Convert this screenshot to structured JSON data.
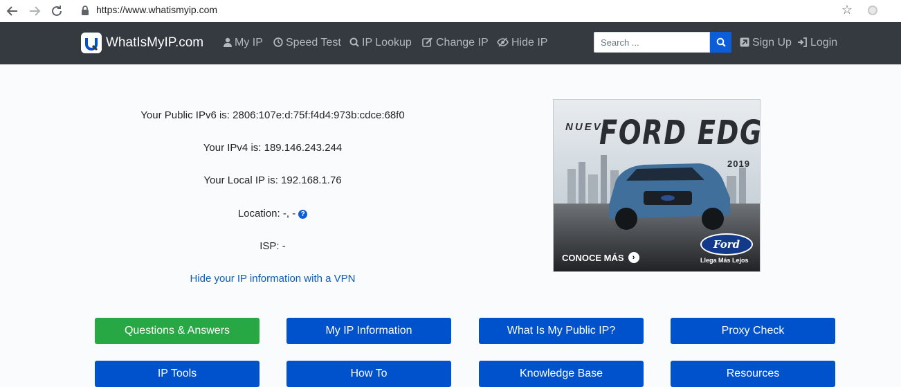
{
  "browser": {
    "url": "https://www.whatismyip.com"
  },
  "navbar": {
    "logo_text": "WhatIsMyIP.com",
    "items": [
      {
        "label": "My IP",
        "icon": "user-icon"
      },
      {
        "label": "Speed Test",
        "icon": "stopwatch-icon"
      },
      {
        "label": "IP Lookup",
        "icon": "search-icon"
      },
      {
        "label": "Change IP",
        "icon": "edit-icon"
      },
      {
        "label": "Hide IP",
        "icon": "eye-slash-icon"
      }
    ],
    "search_placeholder": "Search ...",
    "sign_up": "Sign Up",
    "login": "Login"
  },
  "ip_info": {
    "ipv6": "Your Public IPv6 is: 2806:107e:d:75f:f4d4:973b:cdce:68f0",
    "ipv4": "Your IPv4 is: 189.146.243.244",
    "local_ip": "Your Local IP is: 192.168.1.76",
    "location": "Location: -, -",
    "isp": "ISP: -",
    "vpn_link": "Hide your IP information with a VPN"
  },
  "ad": {
    "nueva": "NUEVA",
    "model": "FORD EDGE",
    "year": "2019",
    "cta": "CONOCE MÁS",
    "brand": "Ford",
    "tagline": "Llega Más Lejos"
  },
  "buttons": {
    "row1": [
      "Questions & Answers",
      "My IP Information",
      "What Is My Public IP?",
      "Proxy Check"
    ],
    "row2": [
      "IP Tools",
      "How To",
      "Knowledge Base",
      "Resources"
    ]
  },
  "colors": {
    "navbar_bg": "#343a40",
    "primary_blue": "#0052cc",
    "green": "#28a745",
    "link_blue": "#0b5ab8"
  }
}
